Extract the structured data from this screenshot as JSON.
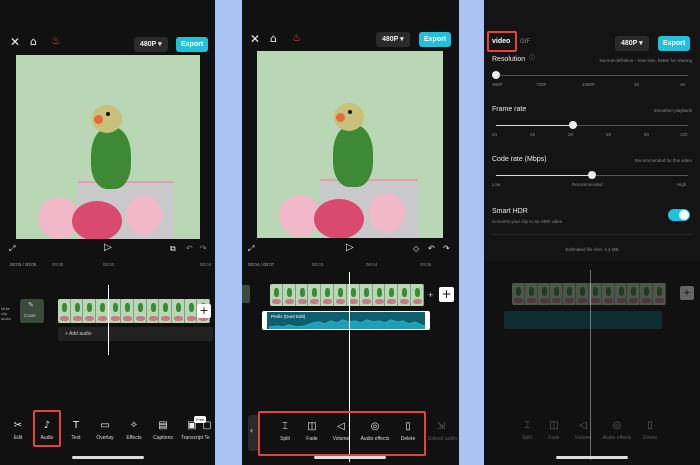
{
  "panel1": {
    "resolution": "480P ▾",
    "export": "Export",
    "time": "00:03 / 00:05",
    "ruler": [
      "00:00",
      "00:02",
      "00:04"
    ],
    "cover": "Cover",
    "mute": "Mute clip audio",
    "add_audio": "+ Add audio",
    "tools": [
      "Edit",
      "Audio",
      "Text",
      "Overlay",
      "Effects",
      "Captions",
      "Transcript",
      "Te"
    ],
    "badge": "Free"
  },
  "panel2": {
    "resolution": "480P ▾",
    "export": "Export",
    "time": "00:04 / 00:07",
    "ruler": [
      "00:03",
      "00:04",
      "00:05"
    ],
    "clip_label": "Prefix (Dont Edit)",
    "tools": [
      "Split",
      "Fade",
      "Volume",
      "Audio effects",
      "Delete"
    ],
    "extra_tool": "Extract audio"
  },
  "panel3": {
    "tab_video": "video",
    "tab_gif": "GIF",
    "resolution": "480P ▾",
    "export": "Export",
    "resolution_title": "Resolution",
    "resolution_hint": "Normal definition – less loss, better for sharing",
    "resolution_ticks": [
      "480P",
      "720P",
      "1080P",
      "2K",
      "4K"
    ],
    "resolution_level": 0.0,
    "framerate_title": "Frame rate",
    "framerate_hint": "Smoother playback",
    "framerate_ticks": [
      "24",
      "25",
      "30",
      "50",
      "60",
      "120"
    ],
    "framerate_level": 0.4,
    "coderate_title": "Code rate (Mbps)",
    "coderate_hint": "Recommended for this video",
    "coderate_ticks": [
      "Low",
      "Recommended",
      "High"
    ],
    "coderate_level": 0.5,
    "hdr_title": "Smart HDR",
    "hdr_desc": "Converts your clip to an HDR video",
    "estimated": "Estimated file size: 4.2 MB",
    "bg_tools": [
      "Split",
      "Fade",
      "Volume",
      "Audio effects",
      "Delete"
    ]
  }
}
